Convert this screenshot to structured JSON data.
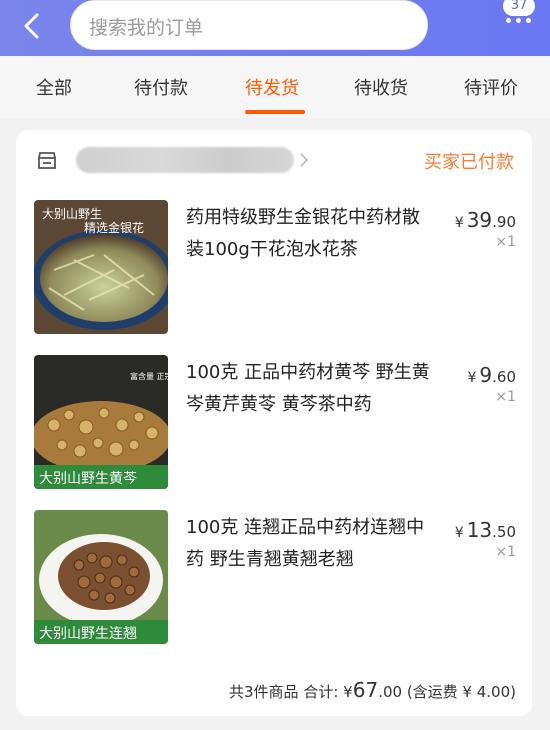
{
  "header": {
    "search_placeholder": "搜索我的订单",
    "message_count": "37"
  },
  "tabs": [
    {
      "label": "全部"
    },
    {
      "label": "待付款"
    },
    {
      "label": "待发货"
    },
    {
      "label": "待收货"
    },
    {
      "label": "待评价"
    }
  ],
  "order": {
    "status": "买家已付款",
    "items": [
      {
        "title": "药用特级野生金银花中药材散装100g干花泡水花茶",
        "price_currency": "¥",
        "price_int": "39",
        "price_dec": ".90",
        "qty": "×1",
        "image_caption_1": "大别山野生",
        "image_caption_2": "精选金银花"
      },
      {
        "title": "100克 正品中药材黄芩  野生黄岑黄芹黄苓 黄芩茶中药",
        "price_currency": "¥",
        "price_int": "9",
        "price_dec": ".60",
        "qty": "×1",
        "image_caption_1": "大别山野生黄芩",
        "image_caption_2": "富含量 正宗货"
      },
      {
        "title": "100克 连翘正品中药材连翘中药 野生青翘黄翘老翘",
        "price_currency": "¥",
        "price_int": "13",
        "price_dec": ".50",
        "qty": "×1",
        "image_caption_1": "大别山野生连翘",
        "image_caption_2": ""
      }
    ],
    "summary": {
      "count_text": "共3件商品",
      "total_label": "合计:",
      "total_currency": "¥",
      "total_int": "67",
      "total_dec": ".00",
      "shipping_text": "(含运费 ¥ 4.00)"
    }
  },
  "colors": {
    "header_gradient_start": "#7a86ea",
    "header_gradient_end": "#6a78f2",
    "accent_orange": "#ff5a00",
    "status_orange": "#ff7a30"
  },
  "icons": [
    "back-chevron-icon",
    "more-dots-icon",
    "shop-icon",
    "chevron-right-icon"
  ]
}
